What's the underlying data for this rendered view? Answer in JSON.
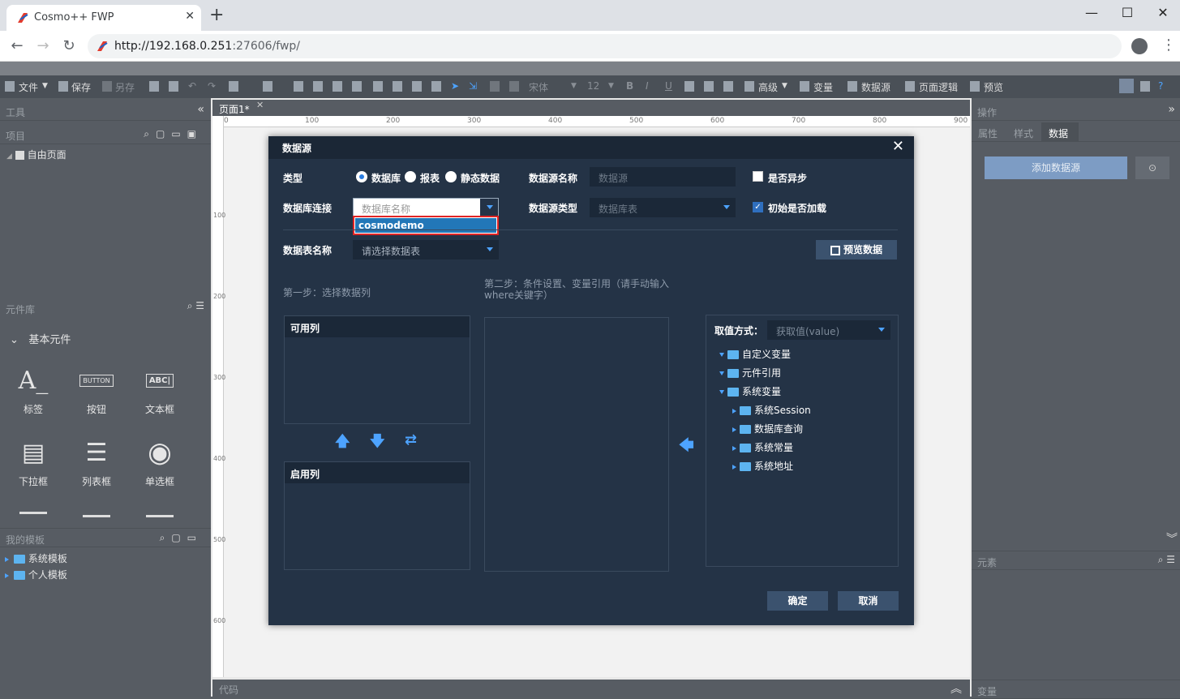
{
  "browser": {
    "tab_title": "Cosmo++ FWP",
    "tab_close": "✕",
    "new_tab": "+",
    "url_host": "http://192.168.0.251",
    "url_rest": ":27606/fwp/",
    "win_min": "—",
    "win_max": "☐",
    "win_close": "✕"
  },
  "toolbar": {
    "file": "文件",
    "save": "保存",
    "save_as": "另存",
    "font_family": "宋体",
    "font_size": "12",
    "advanced": "高级",
    "variables": "变量",
    "datasource": "数据源",
    "page_logic": "页面逻辑",
    "preview": "预览"
  },
  "left": {
    "tools_header": "工具",
    "project_header": "项目",
    "free_page": "自由页面",
    "component_lib": "元件库",
    "basic_components": "基本元件",
    "components": [
      {
        "label": "标签",
        "glyph": "A_"
      },
      {
        "label": "按钮",
        "glyph": "BUTTON"
      },
      {
        "label": "文本框",
        "glyph": "ABC|"
      },
      {
        "label": "下拉框",
        "glyph": "▤"
      },
      {
        "label": "列表框",
        "glyph": "☰"
      },
      {
        "label": "单选框",
        "glyph": "◉"
      }
    ],
    "my_templates": "我的模板",
    "system_templates": "系统模板",
    "personal_templates": "个人模板"
  },
  "canvas": {
    "page_tab": "页面1*",
    "ruler_top": [
      "0",
      "100",
      "200",
      "300",
      "400",
      "500",
      "600",
      "700",
      "800",
      "900"
    ],
    "ruler_left": [
      "100",
      "200",
      "300",
      "400",
      "500",
      "600"
    ],
    "code_label": "代码"
  },
  "right": {
    "operations_header": "操作",
    "tabs": [
      "属性",
      "样式",
      "数据"
    ],
    "add_datasource": "添加数据源",
    "elements_header": "元素",
    "variables_header": "变量"
  },
  "dialog": {
    "title": "数据源",
    "close": "✕",
    "type_label": "类型",
    "type_options": [
      "数据库",
      "报表",
      "静态数据"
    ],
    "ds_name_label": "数据源名称",
    "ds_name_placeholder": "数据源",
    "async_label": "是否异步",
    "db_conn_label": "数据库连接",
    "db_conn_placeholder": "数据库名称",
    "db_conn_option": "cosmodemo",
    "ds_type_label": "数据源类型",
    "ds_type_placeholder": "数据库表",
    "init_load_label": "初始是否加载",
    "table_name_label": "数据表名称",
    "table_placeholder": "请选择数据表",
    "preview_button": "预览数据",
    "step1": "第一步：选择数据列",
    "step2_line1": "第二步：条件设置、变量引用（请手动输入",
    "step2_line2": "where关键字）",
    "available_cols": "可用列",
    "enabled_cols": "启用列",
    "value_mode_label": "取值方式：",
    "value_mode": "获取值(value)",
    "tree": [
      {
        "label": "自定义变量",
        "level": 0
      },
      {
        "label": "元件引用",
        "level": 0
      },
      {
        "label": "系统变量",
        "level": 0
      },
      {
        "label": "系统Session",
        "level": 1
      },
      {
        "label": "数据库查询",
        "level": 1
      },
      {
        "label": "系统常量",
        "level": 1
      },
      {
        "label": "系统地址",
        "level": 1
      }
    ],
    "ok": "确定",
    "cancel": "取消"
  },
  "colors": {
    "dialog_bg": "#243346",
    "accent_blue": "#4da3ff",
    "highlight_red": "#e02424",
    "selected_option": "#2277b8"
  }
}
